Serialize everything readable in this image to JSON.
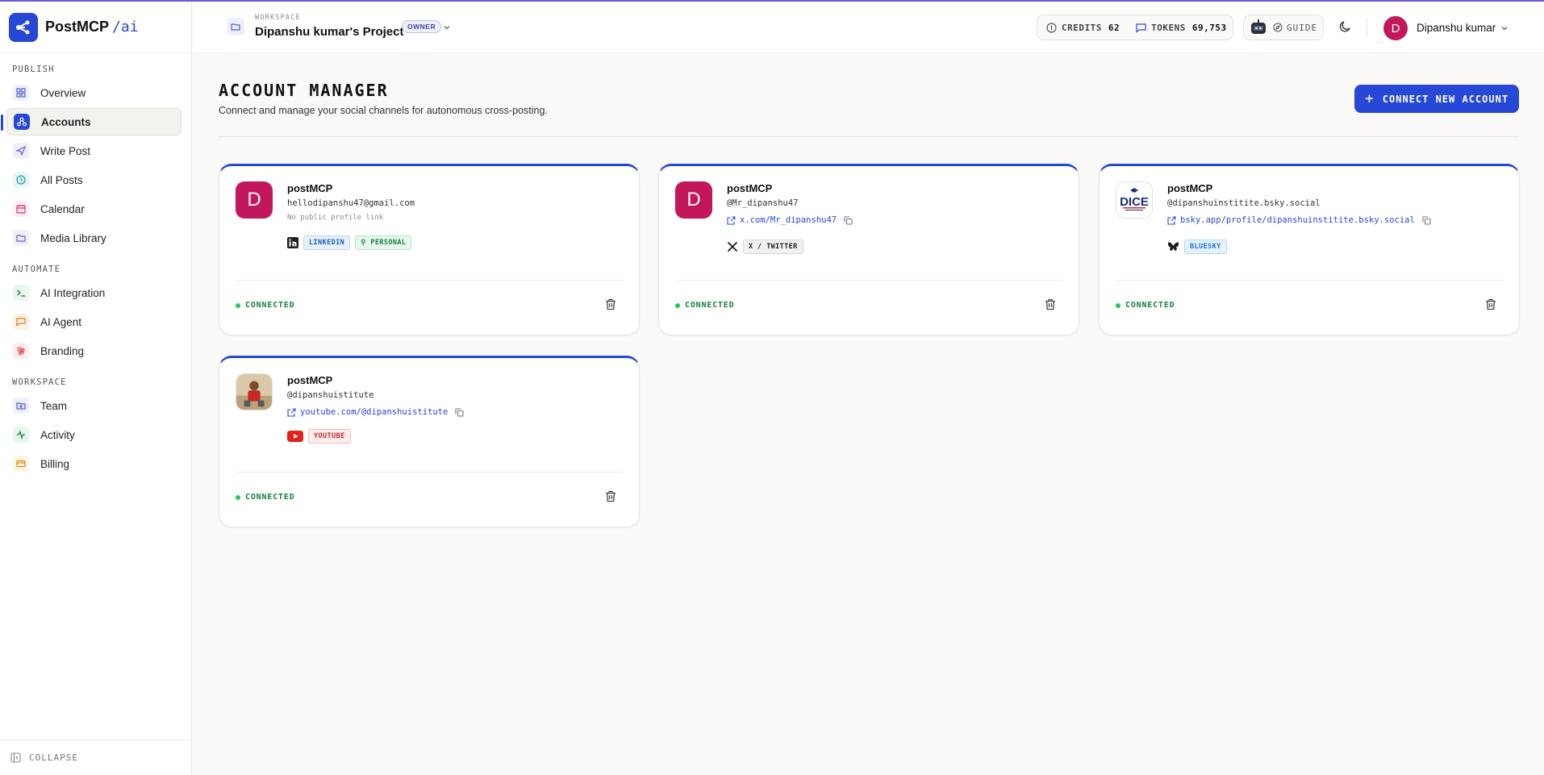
{
  "brand": {
    "name": "PostMCP",
    "suffix": "/ai"
  },
  "sidebar": {
    "sections": [
      {
        "title": "PUBLISH",
        "items": [
          {
            "label": "Overview",
            "icon": "grid-icon"
          },
          {
            "label": "Accounts",
            "icon": "share-nodes-icon",
            "active": true
          },
          {
            "label": "Write Post",
            "icon": "send-icon"
          },
          {
            "label": "All Posts",
            "icon": "clock-icon"
          },
          {
            "label": "Calendar",
            "icon": "calendar-icon"
          },
          {
            "label": "Media Library",
            "icon": "folder-open-icon"
          }
        ]
      },
      {
        "title": "AUTOMATE",
        "items": [
          {
            "label": "AI Integration",
            "icon": "terminal-icon"
          },
          {
            "label": "AI Agent",
            "icon": "chat-icon"
          },
          {
            "label": "Branding",
            "icon": "palette-icon"
          }
        ]
      },
      {
        "title": "WORKSPACE",
        "items": [
          {
            "label": "Team",
            "icon": "team-folder-icon"
          },
          {
            "label": "Activity",
            "icon": "activity-icon"
          },
          {
            "label": "Billing",
            "icon": "credit-card-icon"
          }
        ]
      }
    ],
    "collapse_label": "COLLAPSE"
  },
  "header": {
    "workspace_label": "WORKSPACE",
    "workspace_name": "Dipanshu kumar's Project",
    "role_badge": "OWNER",
    "credits_label": "CREDITS",
    "credits_value": "62",
    "tokens_label": "TOKENS",
    "tokens_value": "69,753",
    "guide_label": "GUIDE",
    "user_initial": "D",
    "user_name": "Dipanshu kumar"
  },
  "main": {
    "title": "ACCOUNT MANAGER",
    "subtitle": "Connect and manage your social channels for autonomous cross-posting.",
    "connect_button": "CONNECT NEW ACCOUNT"
  },
  "accounts": [
    {
      "name": "postMCP",
      "handle": "hellodipanshu47@gmail.com",
      "no_link_text": "No public profile link",
      "tags": [
        "LINKEDIN",
        "PERSONAL"
      ],
      "status": "CONNECTED",
      "initial": "D"
    },
    {
      "name": "postMCP",
      "handle": "@Mr_dipanshu47",
      "link": "x.com/Mr_dipanshu47",
      "tags": [
        "X / TWITTER"
      ],
      "status": "CONNECTED",
      "initial": "D"
    },
    {
      "name": "postMCP",
      "handle": "@dipanshuinstitite.bsky.social",
      "link": "bsky.app/profile/dipanshuinstitite.bsky.social",
      "tags": [
        "BLUESKY"
      ],
      "status": "CONNECTED",
      "logo_text": "DICE"
    },
    {
      "name": "postMCP",
      "handle": "@dipanshuistitute",
      "link": "youtube.com/@dipanshuistitute",
      "tags": [
        "YOUTUBE"
      ],
      "status": "CONNECTED"
    }
  ],
  "colors": {
    "accent": "#2747d6",
    "connected": "#15803d",
    "avatar": "#c2185b"
  }
}
